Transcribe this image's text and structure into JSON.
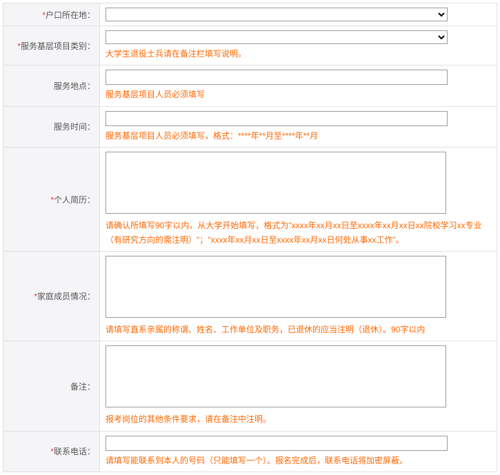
{
  "fields": {
    "hukou": {
      "label": "户口所在地：",
      "required": true
    },
    "category": {
      "label": "服务基层项目类别：",
      "required": true,
      "hint": "大学生退役士兵请在备注栏填写说明。"
    },
    "location": {
      "label": "服务地点：",
      "required": false,
      "hint": "服务基层项目人员必须填写"
    },
    "time": {
      "label": "服务时间：",
      "required": false,
      "hint": "服务基层项目人员必须填写，格式：****年**月至****年**月"
    },
    "resume": {
      "label": "个人简历：",
      "required": true,
      "hint": "请确认所填写90字以内，从大学开始填写，格式为\"xxxx年xx月xx日至xxxx年xx月xx日xx院校学习xx专业（有研究方向的需注明）\"；\"xxxx年xx月xx日至xxxx年xx月xx日何处从事xx工作\"。"
    },
    "family": {
      "label": "家庭成员情况：",
      "required": true,
      "hint": "请填写直系亲属的称谓、姓名、工作单位及职务，已退休的应当注明（退休）。90字以内"
    },
    "remark": {
      "label": "备注：",
      "required": false,
      "hint": "报考岗位的其他条件要求，请在备注中注明。"
    },
    "phone": {
      "label": "联系电话：",
      "required": true,
      "hint": "请填写能联系到本人的号码（只能填写一个）。报名完成后，联系电话将加密屏蔽。"
    }
  }
}
